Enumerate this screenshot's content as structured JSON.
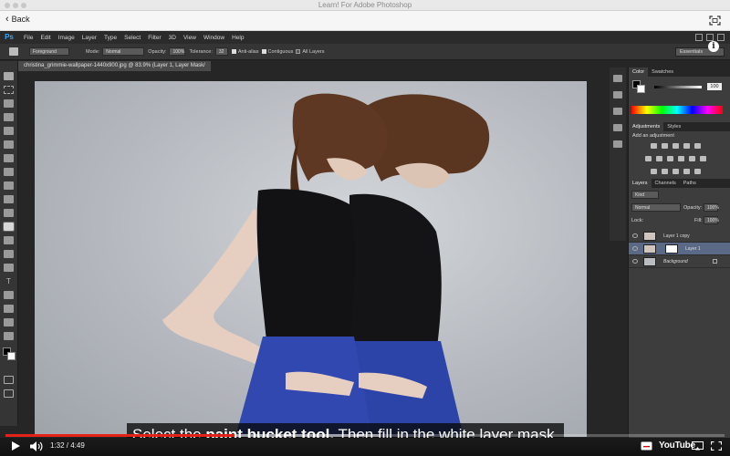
{
  "window": {
    "title": "Learn! For Adobe Photoshop"
  },
  "nav": {
    "back_label": "Back",
    "fullscreen_icon": "fullscreen-icon"
  },
  "photoshop": {
    "logo": "Ps",
    "menus": [
      "File",
      "Edit",
      "Image",
      "Layer",
      "Type",
      "Select",
      "Filter",
      "3D",
      "View",
      "Window",
      "Help"
    ],
    "options": {
      "fill_source": "Foreground",
      "mode_label": "Mode:",
      "mode_value": "Normal",
      "opacity_label": "Opacity:",
      "opacity_value": "100%",
      "tolerance_label": "Tolerance:",
      "tolerance_value": "32",
      "anti_alias": "Anti-alias",
      "contiguous": "Contiguous",
      "all_layers": "All Layers",
      "workspace": "Essentials"
    },
    "document_tab": "christina_grimmie-wallpaper-1440x900.jpg @ 83.9% (Layer 1, Layer Mask/",
    "panels": {
      "color_tabs": [
        "Color",
        "Swatches"
      ],
      "color_value": "100",
      "adjustments_tabs": [
        "Adjustments",
        "Styles"
      ],
      "adjustments_hint": "Add an adjustment",
      "layers_tabs": [
        "Layers",
        "Channels",
        "Paths"
      ],
      "layers_kind": "Kind",
      "blend_mode": "Normal",
      "opacity_label": "Opacity:",
      "opacity_value": "100%",
      "lock_label": "Lock:",
      "fill_label": "Fill:",
      "fill_value": "100%",
      "layers": [
        {
          "name": "Layer 1 copy",
          "selected": false
        },
        {
          "name": "Layer 1",
          "selected": true
        },
        {
          "name": "Background",
          "selected": false
        }
      ]
    }
  },
  "caption": {
    "pre": "Select the ",
    "bold": "paint bucket tool.",
    "post": " Then fill in the white layer mask."
  },
  "player": {
    "current_time": "1:32",
    "duration": "4:49",
    "time_display": "1:32 / 4:49",
    "played_fraction": 0.318,
    "loaded_fraction": 0.52,
    "brand": "YouTube",
    "accent": "#e62117"
  }
}
